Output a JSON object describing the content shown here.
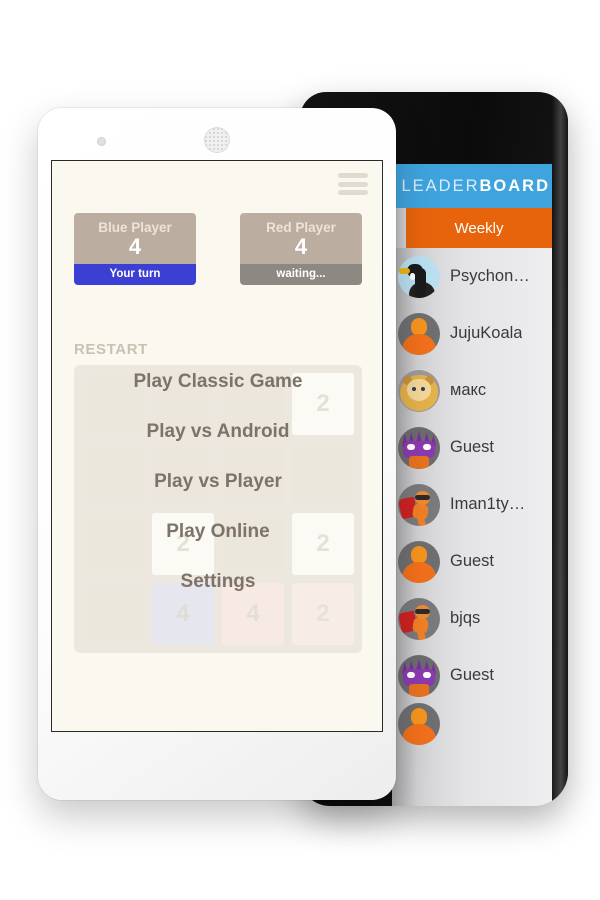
{
  "leaderboard": {
    "title_light": "LEADER",
    "title_bold": "BOARD",
    "tabs": [
      {
        "label": "Weekly",
        "active": true
      }
    ],
    "entries": [
      {
        "name": "Psychon…",
        "avatar": "goose-avatar"
      },
      {
        "name": "JujuKoala",
        "avatar": "bust-avatar"
      },
      {
        "name": "макс",
        "avatar": "lion-avatar"
      },
      {
        "name": "Guest",
        "avatar": "monster-avatar"
      },
      {
        "name": "Iman1ty…",
        "avatar": "hero-avatar"
      },
      {
        "name": "Guest",
        "avatar": "bust-avatar"
      },
      {
        "name": "bjqs",
        "avatar": "hero-avatar"
      },
      {
        "name": "Guest",
        "avatar": "monster-avatar"
      }
    ],
    "colors": {
      "header": "#3fa3dd",
      "tab_active": "#e8640c",
      "list_bg": "#e4e4e6"
    }
  },
  "game": {
    "menu_icon": "hamburger-icon",
    "restart_label": "RESTART",
    "players": [
      {
        "label": "Blue Player",
        "score": "4",
        "status": "Your turn",
        "status_color": "#3b3fd4"
      },
      {
        "label": "Red Player",
        "score": "4",
        "status": "waiting...",
        "status_color": "#8d8881"
      }
    ],
    "board": {
      "rows": [
        [
          {
            "v": ""
          },
          {
            "v": ""
          },
          {
            "v": ""
          },
          {
            "v": "2",
            "style": "t-2"
          }
        ],
        [
          {
            "v": ""
          },
          {
            "v": ""
          },
          {
            "v": ""
          },
          {
            "v": ""
          }
        ],
        [
          {
            "v": ""
          },
          {
            "v": "2",
            "style": "t-2"
          },
          {
            "v": ""
          },
          {
            "v": "2",
            "style": "t-2"
          }
        ],
        [
          {
            "v": ""
          },
          {
            "v": "4",
            "style": "t-4-blue"
          },
          {
            "v": "4",
            "style": "t-4-red"
          },
          {
            "v": "2",
            "style": "t-2-red"
          }
        ]
      ]
    },
    "menu": [
      {
        "label": "Play Classic Game"
      },
      {
        "label": "Play vs Android"
      },
      {
        "label": "Play vs Player"
      },
      {
        "label": "Play Online"
      },
      {
        "label": "Settings"
      }
    ]
  }
}
